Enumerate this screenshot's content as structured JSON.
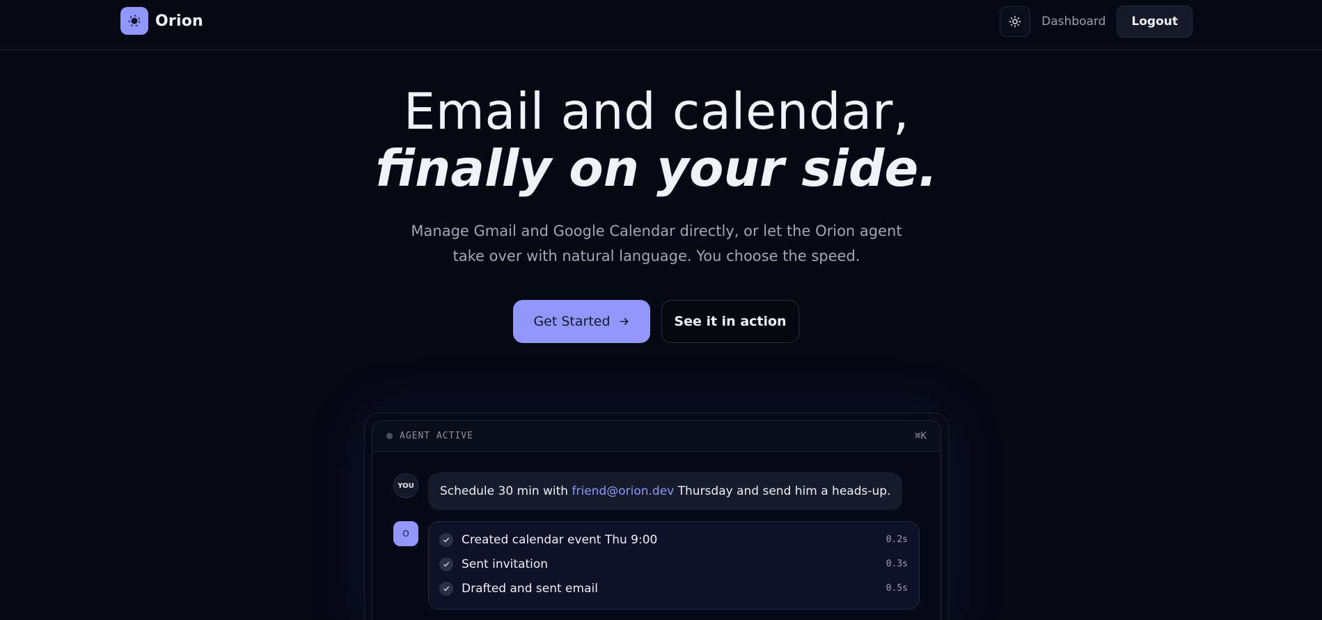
{
  "header": {
    "brand": "Orion",
    "nav": {
      "dashboard": "Dashboard",
      "logout": "Logout"
    }
  },
  "hero": {
    "title_line1": "Email and calendar,",
    "title_line2": "finally on your side.",
    "subtitle_line1": "Manage Gmail and Google Calendar directly, or let the Orion agent",
    "subtitle_line2": "take over with natural language. You choose the speed.",
    "cta_primary": "Get Started",
    "cta_secondary": "See it in action"
  },
  "agent": {
    "status": "AGENT ACTIVE",
    "shortcut": "⌘K",
    "user_avatar": "YOU",
    "user_message_pre": "Schedule 30 min with ",
    "user_message_email": "friend@orion.dev",
    "user_message_post": " Thursday and send him a heads-up.",
    "agent_avatar": "O",
    "steps": [
      {
        "label": "Created calendar event Thu 9:00",
        "time": "0.2s"
      },
      {
        "label": "Sent invitation",
        "time": "0.3s"
      },
      {
        "label": "Drafted and sent email",
        "time": "0.5s"
      }
    ]
  },
  "colors": {
    "background": "#060814",
    "accent": "#9197fb",
    "text": "#f1f2f7",
    "muted": "#a3a8b8"
  },
  "icons": {
    "logo": "orion-logo-icon",
    "theme": "sun-icon",
    "cta_arrow": "arrow-right-icon",
    "step": "check-icon"
  }
}
